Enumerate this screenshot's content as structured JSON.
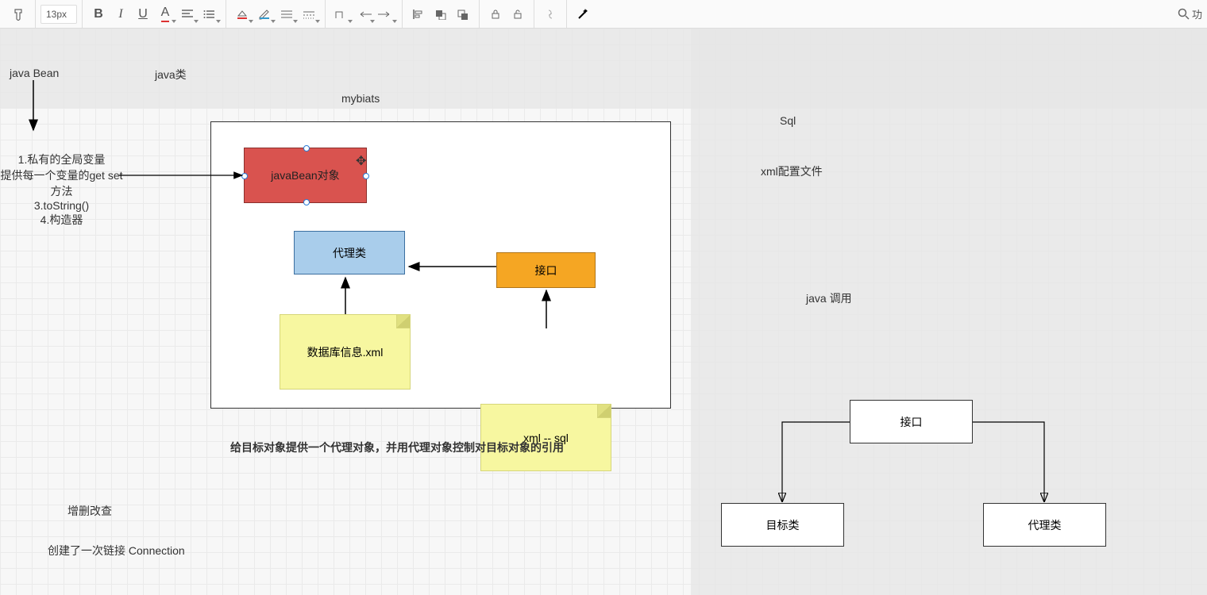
{
  "toolbar": {
    "fontsize": "13px",
    "search_label": "功"
  },
  "labels": {
    "java_bean": "java Bean",
    "java_class": "java类",
    "mybiats": "mybiats",
    "sql": "Sql",
    "xml_config": "xml配置文件",
    "java_call": "java 调用",
    "bean_rules": "1.私有的全局变量\n提供每一个变量的get set\n方法\n3.toString()\n4.构造器",
    "proxy_summary": "给目标对象提供一个代理对象，并用代理对象控制对目标对象的引用",
    "crud": "增删改查",
    "connection": "创建了一次链接 Connection"
  },
  "nodes": {
    "javabean_obj": "javaBean对象",
    "proxy_class": "代理类",
    "interface": "接口",
    "db_info_xml": "数据库信息.xml",
    "xml_sql": "xml  -- sql",
    "interface2": "接口",
    "target_class": "目标类",
    "proxy_class2": "代理类"
  }
}
